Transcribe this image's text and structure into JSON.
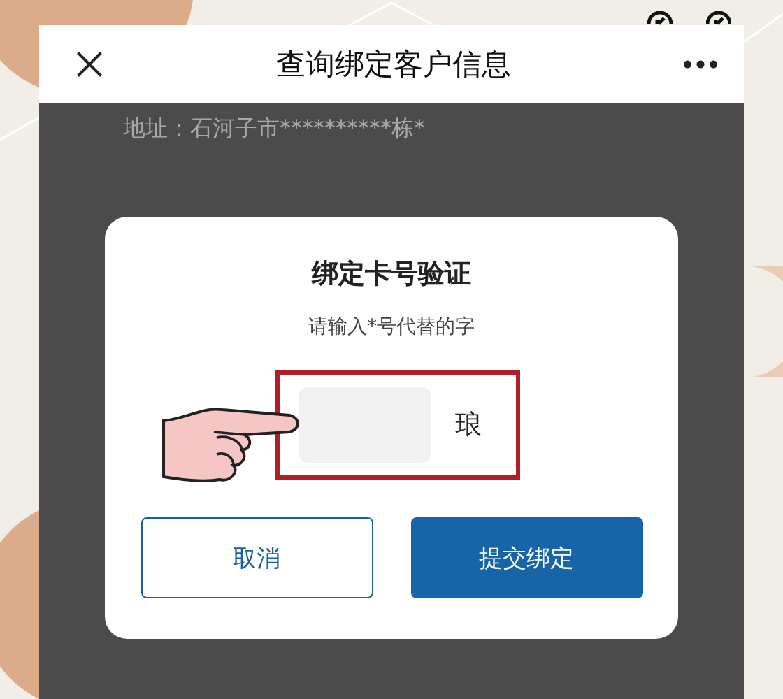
{
  "header": {
    "title": "查询绑定客户信息"
  },
  "page": {
    "address": "地址：石河子市**********栋*"
  },
  "dialog": {
    "title": "绑定卡号验证",
    "hint": "请输入*号代替的字",
    "answer": {
      "highlighted": true
    },
    "suffix": "琅",
    "buttons": [
      {
        "label": "取消",
        "kind": "secondary"
      },
      {
        "label": "提交绑定",
        "kind": "primary"
      }
    ]
  }
}
